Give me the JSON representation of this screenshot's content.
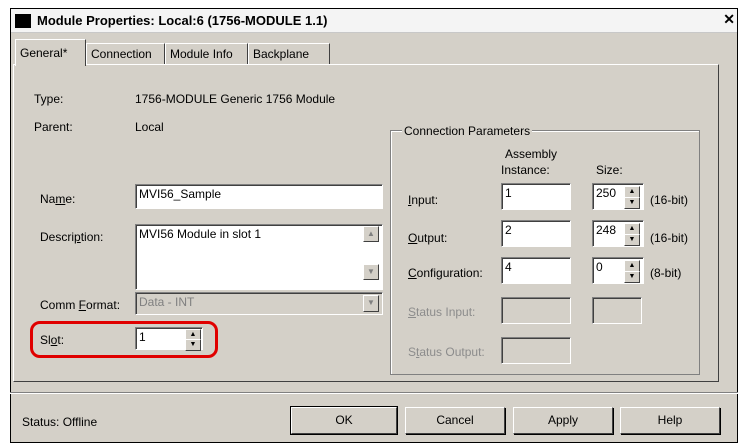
{
  "window": {
    "title": "Module Properties: Local:6 (1756-MODULE 1.1)",
    "close_glyph": "✕"
  },
  "tabs": [
    {
      "label": "General*"
    },
    {
      "label": "Connection"
    },
    {
      "label": "Module Info"
    },
    {
      "label": "Backplane"
    }
  ],
  "general": {
    "type_label": "Type:",
    "type_value": "1756-MODULE Generic 1756 Module",
    "parent_label": "Parent:",
    "parent_value": "Local",
    "name_label_pre": "Na",
    "name_label_u": "m",
    "name_label_post": "e:",
    "name_value": "MVI56_Sample",
    "description_label_pre": "Descri",
    "description_label_u": "p",
    "description_label_post": "tion:",
    "description_value": "MVI56 Module in slot 1",
    "comm_format_label_pre": "Comm ",
    "comm_format_label_u": "F",
    "comm_format_label_post": "ormat:",
    "comm_format_value": "Data - INT",
    "slot_label_pre": "Sl",
    "slot_label_u": "o",
    "slot_label_post": "t:",
    "slot_value": "1"
  },
  "connection_parameters": {
    "title": "Connection Parameters",
    "assembly_header_1": "Assembly",
    "assembly_header_2": "Instance:",
    "size_header": "Size:",
    "rows": [
      {
        "label_pre": "",
        "label_u": "I",
        "label_post": "nput:",
        "instance": "1",
        "size": "250",
        "unit": "(16-bit)"
      },
      {
        "label_pre": "",
        "label_u": "O",
        "label_post": "utput:",
        "instance": "2",
        "size": "248",
        "unit": "(16-bit)"
      },
      {
        "label_pre": "",
        "label_u": "C",
        "label_post": "onfiguration:",
        "instance": "4",
        "size": "0",
        "unit": "(8-bit)"
      }
    ],
    "status_input_label_pre": "",
    "status_input_label_u": "S",
    "status_input_label_post": "tatus Input:",
    "status_output_label_pre": "S",
    "status_output_label_u": "t",
    "status_output_label_post": "atus Output:"
  },
  "footer": {
    "status_text": "Status:  Offline",
    "ok_label": "OK",
    "cancel_label": "Cancel",
    "apply_label": "Apply",
    "help_label": "Help"
  },
  "colors": {
    "dialog_bg": "#d4d0c8",
    "highlight": "#e00000"
  },
  "icons": {
    "spin_up": "▲",
    "spin_down": "▼",
    "scroll_up": "▲",
    "scroll_down": "▼"
  }
}
